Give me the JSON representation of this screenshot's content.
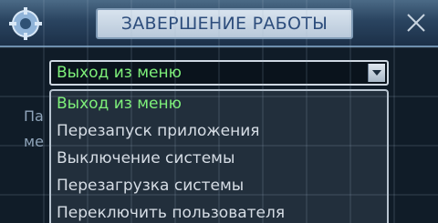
{
  "window": {
    "title": "ЗАВЕРШЕНИЕ РАБОТЫ",
    "icon": "gear-settings-icon",
    "close_icon": "close-icon"
  },
  "background_labels": [
    "Па",
    "ме"
  ],
  "select": {
    "value": "Выход из меню",
    "arrow_icon": "chevron-down-icon"
  },
  "dropdown": {
    "options": [
      "Выход из меню",
      "Перезапуск приложения",
      "Выключение системы",
      "Перезагрузка системы",
      "Переключить пользователя"
    ],
    "selected_index": 0
  },
  "colors": {
    "accent_text": "#7ef07a",
    "title_text": "#2d4d7c"
  }
}
